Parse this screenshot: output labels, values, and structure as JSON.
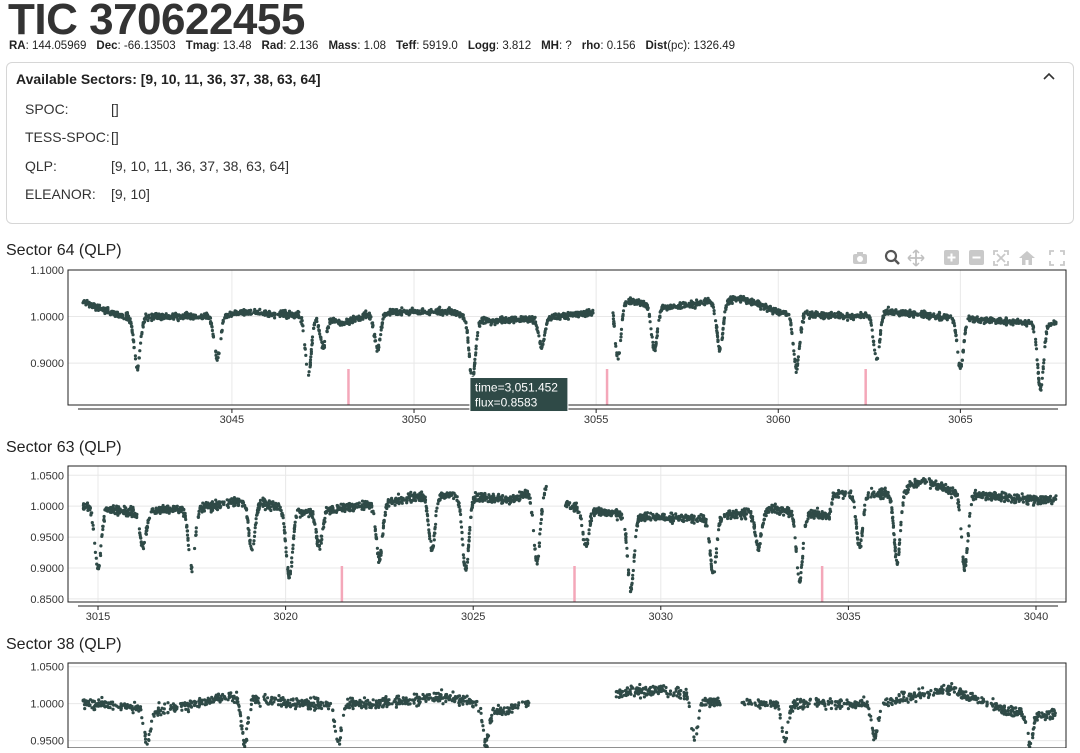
{
  "header": {
    "title": "TIC 370622455",
    "meta": [
      {
        "key": "RA",
        "value": "144.05969"
      },
      {
        "key": "Dec",
        "value": "-66.13503"
      },
      {
        "key": "Tmag",
        "value": "13.48"
      },
      {
        "key": "Rad",
        "value": "2.136"
      },
      {
        "key": "Mass",
        "value": "1.08"
      },
      {
        "key": "Teff",
        "value": "5919.0"
      },
      {
        "key": "Logg",
        "value": "3.812"
      },
      {
        "key": "MH",
        "value": "?"
      },
      {
        "key": "rho",
        "value": "0.156"
      },
      {
        "key": "Dist",
        "unit": "(pc)",
        "value": "1326.49"
      }
    ]
  },
  "sectors": {
    "heading": "Available Sectors: [9, 10, 11, 36, 37, 38, 63, 64]",
    "rows": [
      {
        "label": "SPOC:",
        "value": "[]"
      },
      {
        "label": "TESS-SPOC:",
        "value": "[]"
      },
      {
        "label": "QLP:",
        "value": "[9, 10, 11, 36, 37, 38, 63, 64]"
      },
      {
        "label": "ELEANOR:",
        "value": "[9, 10]"
      }
    ]
  },
  "modebar": [
    "camera-icon",
    "zoom-icon",
    "pan-icon",
    "zoom-in-icon",
    "zoom-out-icon",
    "autoscale-icon",
    "home-icon",
    "fullscreen-icon"
  ],
  "colors": {
    "points": "#2f4a47",
    "markers": "#f4a7b9",
    "grid": "#e8e8e8",
    "tooltip_bg": "#2f4a47"
  },
  "chart_data": [
    {
      "title": "Sector 64 (QLP)",
      "type": "scatter",
      "xlim": [
        3040.5,
        3067.9
      ],
      "ylim": [
        0.81,
        1.1
      ],
      "yticks": [
        0.9,
        1.0,
        1.1
      ],
      "ytick_labels": [
        "0.9000",
        "1.0000",
        "1.1000"
      ],
      "xticks": [
        3045,
        3050,
        3055,
        3060,
        3065
      ],
      "baseline": [
        [
          3040.6,
          1.04
        ],
        [
          3042.0,
          1.0
        ],
        [
          3044.5,
          1.0
        ],
        [
          3045.5,
          1.01
        ],
        [
          3047.5,
          1.0
        ],
        [
          3048.0,
          0.985
        ],
        [
          3049.0,
          1.01
        ],
        [
          3051.0,
          1.01
        ],
        [
          3052.0,
          0.99
        ],
        [
          3054.0,
          1.0
        ],
        [
          3055.0,
          1.01
        ],
        [
          3055.4,
          1.04
        ],
        [
          3057.0,
          1.02
        ],
        [
          3059.0,
          1.04
        ],
        [
          3060.0,
          1.01
        ],
        [
          3062.0,
          1.0
        ],
        [
          3063.0,
          1.01
        ],
        [
          3066.0,
          0.99
        ],
        [
          3067.8,
          0.985
        ]
      ],
      "gaps": [
        [
          3054.95,
          3055.45
        ]
      ],
      "dips": [
        [
          3042.4,
          0.89
        ],
        [
          3044.6,
          0.91
        ],
        [
          3047.1,
          0.88
        ],
        [
          3047.5,
          0.935
        ],
        [
          3049.0,
          0.93
        ],
        [
          3051.6,
          0.865
        ],
        [
          3053.5,
          0.935
        ],
        [
          3055.6,
          0.91
        ],
        [
          3056.6,
          0.93
        ],
        [
          3058.4,
          0.93
        ],
        [
          3060.5,
          0.89
        ],
        [
          3062.7,
          0.91
        ],
        [
          3065.0,
          0.89
        ],
        [
          3067.2,
          0.845
        ]
      ],
      "markers": [
        3048.2,
        3055.3,
        3062.4
      ],
      "tooltip": {
        "time": "3,051.452",
        "flux": "0.8583",
        "x": 3051.452,
        "y": 0.8583
      }
    },
    {
      "title": "Sector 63 (QLP)",
      "type": "scatter",
      "xlim": [
        3014.2,
        3040.8
      ],
      "ylim": [
        0.845,
        1.065
      ],
      "yticks": [
        0.85,
        0.9,
        0.95,
        1.0,
        1.05
      ],
      "ytick_labels": [
        "0.8500",
        "0.9000",
        "0.9500",
        "1.0000",
        "1.0500"
      ],
      "xticks": [
        3015,
        3020,
        3025,
        3030,
        3035,
        3040
      ],
      "baseline": [
        [
          3014.5,
          1.0
        ],
        [
          3016.0,
          0.99
        ],
        [
          3018.0,
          1.0
        ],
        [
          3019.0,
          1.01
        ],
        [
          3020.5,
          0.99
        ],
        [
          3022.0,
          1.0
        ],
        [
          3024.0,
          1.02
        ],
        [
          3026.0,
          1.01
        ],
        [
          3027.2,
          1.035
        ],
        [
          3027.5,
          1.0
        ],
        [
          3029.0,
          0.985
        ],
        [
          3031.0,
          0.98
        ],
        [
          3033.0,
          0.995
        ],
        [
          3034.5,
          0.985
        ],
        [
          3034.6,
          1.02
        ],
        [
          3036.0,
          1.02
        ],
        [
          3037.0,
          1.04
        ],
        [
          3038.0,
          1.02
        ],
        [
          3040.0,
          1.01
        ]
      ],
      "gaps": [
        [
          3026.95,
          3027.45
        ]
      ],
      "dips": [
        [
          3015.0,
          0.9
        ],
        [
          3016.2,
          0.935
        ],
        [
          3017.5,
          0.895
        ],
        [
          3019.1,
          0.93
        ],
        [
          3020.1,
          0.885
        ],
        [
          3020.9,
          0.935
        ],
        [
          3022.5,
          0.915
        ],
        [
          3023.9,
          0.93
        ],
        [
          3024.8,
          0.895
        ],
        [
          3026.7,
          0.91
        ],
        [
          3028.0,
          0.935
        ],
        [
          3029.2,
          0.865
        ],
        [
          3031.4,
          0.89
        ],
        [
          3032.6,
          0.935
        ],
        [
          3033.7,
          0.88
        ],
        [
          3035.3,
          0.935
        ],
        [
          3036.3,
          0.91
        ],
        [
          3038.1,
          0.9
        ]
      ],
      "markers": [
        3021.5,
        3027.7,
        3034.3
      ],
      "tooltip": null
    },
    {
      "title": "Sector 38 (QLP)",
      "type": "scatter",
      "xlim": [
        2332.5,
        2360.2
      ],
      "ylim": [
        0.94,
        1.055
      ],
      "yticks": [
        0.95,
        1.0,
        1.05
      ],
      "ytick_labels": [
        "0.9500",
        "1.0000",
        "1.0500"
      ],
      "xticks": [],
      "baseline": [
        [
          2333.5,
          1.0
        ],
        [
          2335.0,
          0.99
        ],
        [
          2337.0,
          1.01
        ],
        [
          2339.0,
          1.0
        ],
        [
          2341.0,
          1.0
        ],
        [
          2343.0,
          1.01
        ],
        [
          2344.5,
          0.99
        ],
        [
          2345.2,
          1.0
        ],
        [
          2349.0,
          1.02
        ],
        [
          2350.5,
          1.0
        ],
        [
          2353.0,
          1.0
        ],
        [
          2355.0,
          1.0
        ],
        [
          2357.0,
          1.02
        ],
        [
          2358.5,
          0.99
        ],
        [
          2360.0,
          0.985
        ]
      ],
      "gaps": [
        [
          2345.3,
          2347.7
        ],
        [
          2350.6,
          2351.2
        ]
      ],
      "dips": [
        [
          2334.7,
          0.945
        ],
        [
          2337.4,
          0.945
        ],
        [
          2340.0,
          0.945
        ],
        [
          2344.1,
          0.945
        ],
        [
          2349.9,
          0.95
        ],
        [
          2352.4,
          0.95
        ],
        [
          2354.9,
          0.955
        ],
        [
          2359.2,
          0.945
        ]
      ],
      "markers": [],
      "tooltip": null
    }
  ]
}
